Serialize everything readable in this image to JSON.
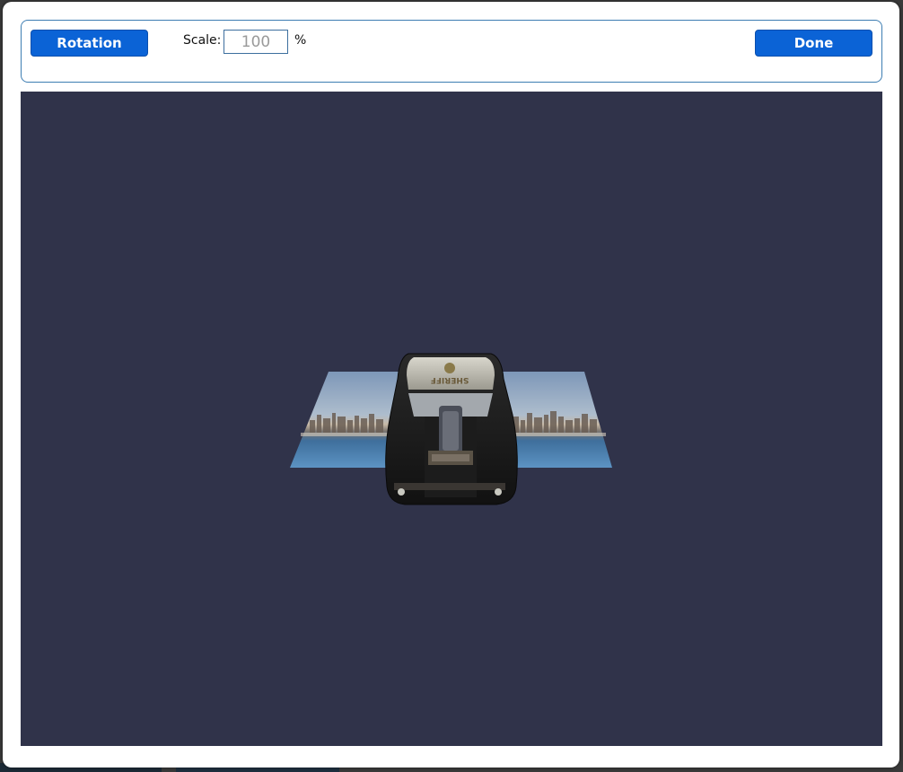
{
  "toolbar": {
    "rotation_label": "Rotation",
    "scale_label": "Scale:",
    "scale_value": "100",
    "scale_unit": "%",
    "done_label": "Done"
  },
  "colors": {
    "button": "#0b63d6",
    "viewport_bg": "#30334a",
    "toolbar_border": "#3d7db2"
  },
  "viewport": {
    "icons": [
      "city-backdrop-plane",
      "police-car-model"
    ]
  }
}
